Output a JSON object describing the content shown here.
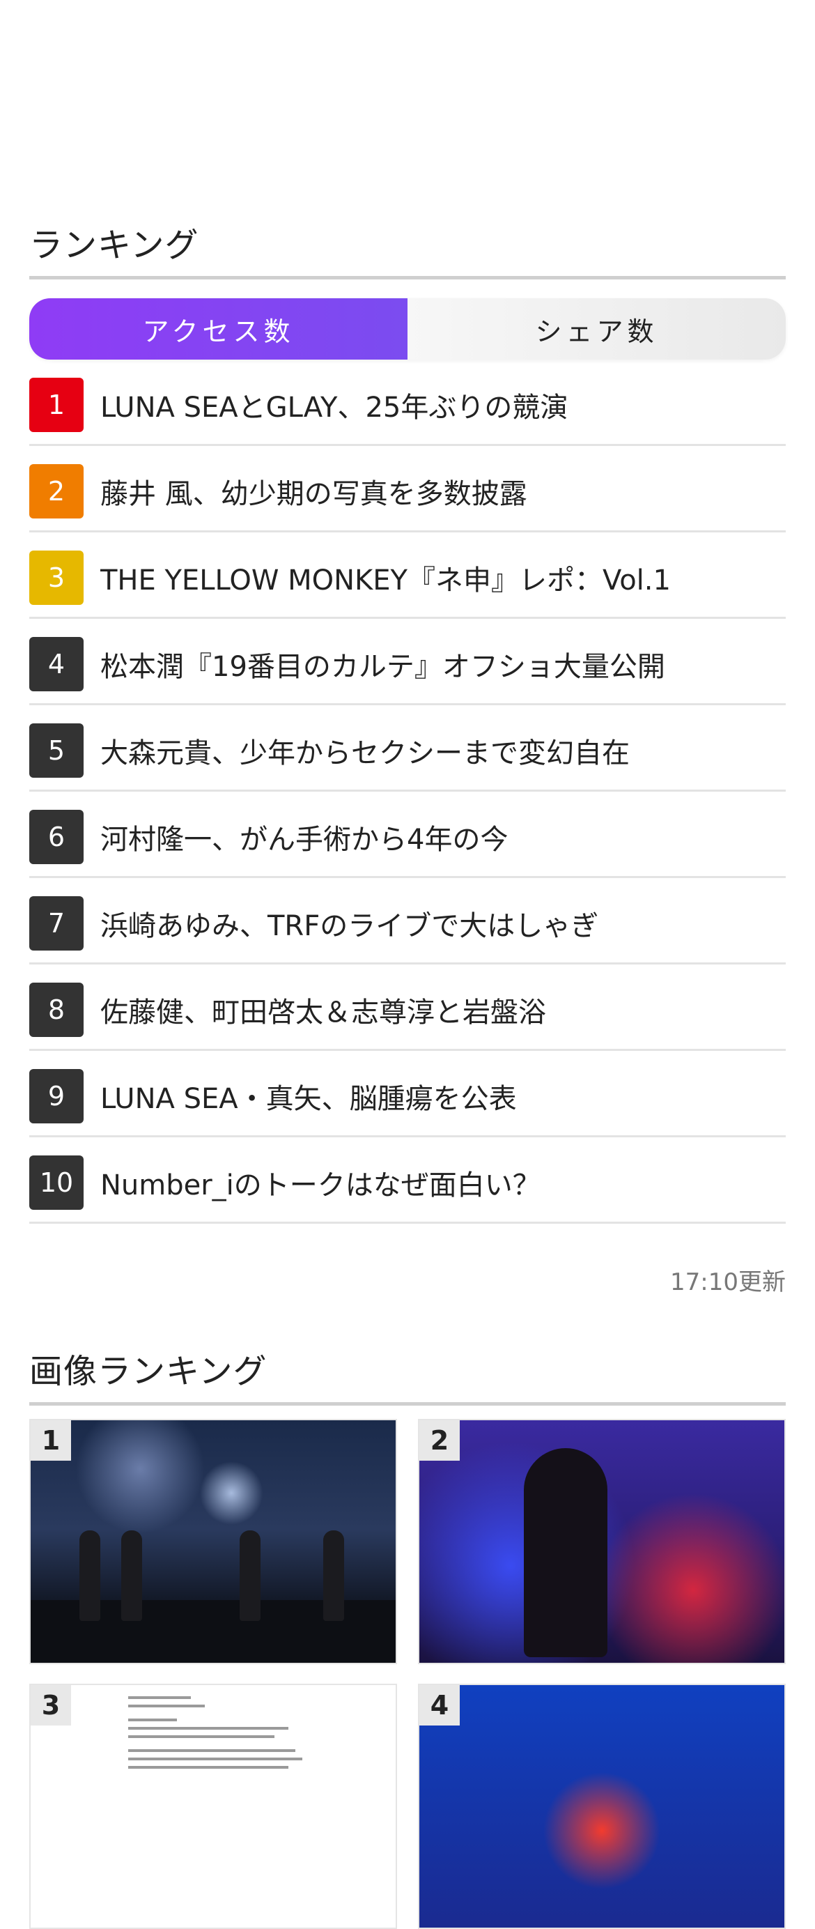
{
  "ranking": {
    "title": "ランキング",
    "tabs": [
      {
        "label": "アクセス数",
        "active": true
      },
      {
        "label": "シェア数",
        "active": false
      }
    ],
    "items": [
      {
        "rank": "1",
        "text": "LUNA SEAとGLAY、25年ぶりの競演",
        "color": "#e60012"
      },
      {
        "rank": "2",
        "text": "藤井 風、幼少期の写真を多数披露",
        "color": "#f07d00"
      },
      {
        "rank": "3",
        "text": "THE YELLOW MONKEY『ネ申』レポ：Vol.1",
        "color": "#e6b800"
      },
      {
        "rank": "4",
        "text": "松本潤『19番目のカルテ』オフショ大量公開",
        "color": "#333333"
      },
      {
        "rank": "5",
        "text": "大森元貴、少年からセクシーまで変幻自在",
        "color": "#333333"
      },
      {
        "rank": "6",
        "text": "河村隆一、がん手術から4年の今",
        "color": "#333333"
      },
      {
        "rank": "7",
        "text": "浜崎あゆみ、TRFのライブで大はしゃぎ",
        "color": "#333333"
      },
      {
        "rank": "8",
        "text": "佐藤健、町田啓太＆志尊淳と岩盤浴",
        "color": "#333333"
      },
      {
        "rank": "9",
        "text": "LUNA SEA・真矢、脳腫瘍を公表",
        "color": "#333333"
      },
      {
        "rank": "10",
        "text": "Number_iのトークはなぜ面白い？",
        "color": "#333333"
      }
    ],
    "updated": "17:10更新"
  },
  "image_ranking": {
    "title": "画像ランキング",
    "items": [
      {
        "rank": "1"
      },
      {
        "rank": "2"
      },
      {
        "rank": "3"
      },
      {
        "rank": "4"
      }
    ]
  },
  "colors": {
    "accent_gradient_start": "#8f3cf5",
    "accent_gradient_end": "#7b4cf0"
  }
}
